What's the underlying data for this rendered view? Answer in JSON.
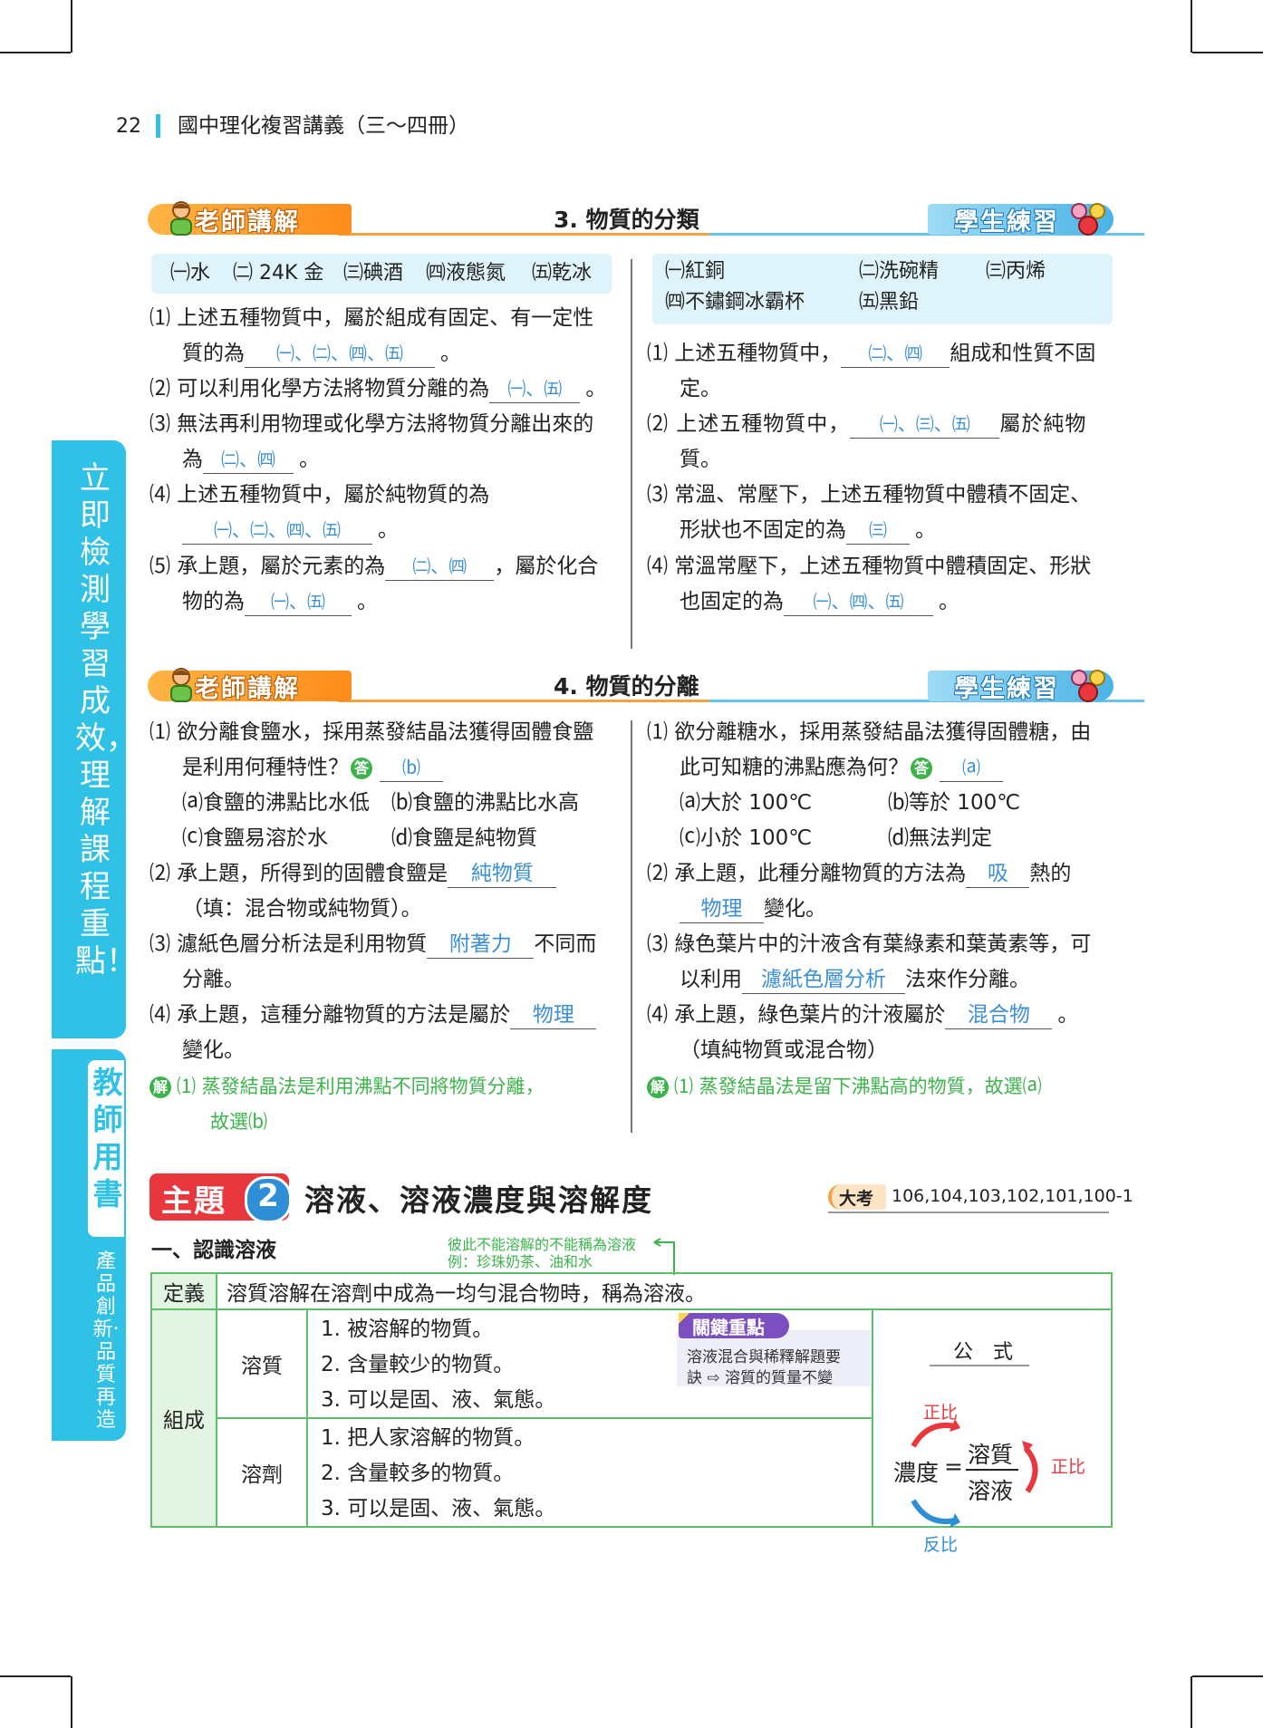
{
  "header": {
    "page_number": "22",
    "book_title": "國中理化複習講義（三～四冊）"
  },
  "sidebar": {
    "main_text": "立即檢測學習成效，理解課程重點！",
    "teacher_book": "教師用書",
    "slogan": "產品創新‧品質再造"
  },
  "banners": {
    "teacher_label": "老師講解",
    "student_label": "學生練習"
  },
  "section3": {
    "title": "3. 物質的分類",
    "left_box": [
      "㈠水",
      "㈡ 24K 金",
      "㈢碘酒",
      "㈣液態氮",
      "㈤乾冰"
    ],
    "right_box": [
      "㈠紅銅",
      "㈡洗碗精",
      "㈢丙烯",
      "㈣不鏽鋼冰霸杯",
      "㈤黑鉛"
    ],
    "left_q1_a": "⑴ 上述五種物質中，屬於組成有固定、有一定性",
    "left_q1_b": "質的為",
    "left_q1_ans": "㈠、㈡、㈣、㈤",
    "left_q2": "⑵ 可以利用化學方法將物質分離的為",
    "left_q2_ans": "㈠、㈤",
    "left_q3_a": "⑶ 無法再利用物理或化學方法將物質分離出來的",
    "left_q3_b": "為",
    "left_q3_ans": "㈡、㈣",
    "left_q4_a": "⑷ 上述五種物質中，屬於純物質的為",
    "left_q4_ans": "㈠、㈡、㈣、㈤",
    "left_q5_a": "⑸ 承上題，屬於元素的為",
    "left_q5_ans1": "㈡、㈣",
    "left_q5_mid": "，屬於化合",
    "left_q5_b": "物的為",
    "left_q5_ans2": "㈠、㈤",
    "right_q1_a": "⑴ 上述五種物質中，",
    "right_q1_ans": "㈡、㈣",
    "right_q1_b": "組成和性質不固",
    "right_q1_c": "定。",
    "right_q2_a": "⑵ 上述五種物質中，",
    "right_q2_ans": "㈠、㈢、㈤",
    "right_q2_b": "屬於純物",
    "right_q2_c": "質。",
    "right_q3_a": "⑶ 常溫、常壓下，上述五種物質中體積不固定、",
    "right_q3_b": "形狀也不固定的為",
    "right_q3_ans": "㈢",
    "right_q4_a": "⑷ 常溫常壓下，上述五種物質中體積固定、形狀",
    "right_q4_b": "也固定的為",
    "right_q4_ans": "㈠、㈣、㈤",
    "period": "。"
  },
  "section4": {
    "title": "4. 物質的分離",
    "left_q1_a": "⑴ 欲分離食鹽水，採用蒸發結晶法獲得固體食鹽",
    "left_q1_b": "是利用何種特性？",
    "answer_mark": "答",
    "left_q1_ans": "⒝",
    "left_q1_opt_a": "⒜食鹽的沸點比水低",
    "left_q1_opt_b": "⒝食鹽的沸點比水高",
    "left_q1_opt_c": "⒞食鹽易溶於水",
    "left_q1_opt_d": "⒟食鹽是純物質",
    "left_q2_a": "⑵ 承上題，所得到的固體食鹽是",
    "left_q2_ans": "純物質",
    "left_q2_b": "（填：混合物或純物質）。",
    "left_q3_a": "⑶ 濾紙色層分析法是利用物質",
    "left_q3_ans": "附著力",
    "left_q3_b": "不同而",
    "left_q3_c": "分離。",
    "left_q4_a": "⑷ 承上題，這種分離物質的方法是屬於",
    "left_q4_ans": "物理",
    "left_q4_b": "變化。",
    "explain_mark": "解",
    "left_explain_a": "⑴ 蒸發結晶法是利用沸點不同將物質分離，",
    "left_explain_b": "故選⒝",
    "right_q1_a": "⑴ 欲分離糖水，採用蒸發結晶法獲得固體糖，由",
    "right_q1_b": "此可知糖的沸點應為何？",
    "right_q1_ans": "⒜",
    "right_q1_opt_a": "⒜大於 100℃",
    "right_q1_opt_b": "⒝等於 100℃",
    "right_q1_opt_c": "⒞小於 100℃",
    "right_q1_opt_d": "⒟無法判定",
    "right_q2_a": "⑵ 承上題，此種分離物質的方法為",
    "right_q2_ans1": "吸",
    "right_q2_b": "熱的",
    "right_q2_ans2": "物理",
    "right_q2_c": "變化。",
    "right_q3_a": "⑶ 綠色葉片中的汁液含有葉綠素和葉黃素等，可",
    "right_q3_b": "以利用",
    "right_q3_ans": "濾紙色層分析",
    "right_q3_c": "法來作分離。",
    "right_q4_a": "⑷ 承上題，綠色葉片的汁液屬於",
    "right_q4_ans": "混合物",
    "right_q4_b": "（填純物質或混合物）",
    "right_explain": "⑴ 蒸發結晶法是留下沸點高的物質，故選⒜",
    "period": "。"
  },
  "topic2": {
    "label": "主題",
    "number": "2",
    "title": "溶液、溶液濃度與溶解度",
    "exam_label": "大考",
    "exam_years": "106,104,103,102,101,100-1",
    "subheading": "一、認識溶液",
    "note_line1": "彼此不能溶解的不能稱為溶液",
    "note_line2": "例：珍珠奶茶、油和水",
    "table": {
      "def_label": "定義",
      "def_text": "溶質溶解在溶劑中成為一均勻混合物時，稱為溶液。",
      "comp_label": "組成",
      "solute_label": "溶質",
      "solute_items": [
        "1. 被溶解的物質。",
        "2. 含量較少的物質。",
        "3. 可以是固、液、氣態。"
      ],
      "solvent_label": "溶劑",
      "solvent_items": [
        "1. 把人家溶解的物質。",
        "2. 含量較多的物質。",
        "3. 可以是固、液、氣態。"
      ],
      "key_label": "關鍵重點",
      "key_text_1": "溶液混合與稀釋解題要",
      "key_text_2": "訣 ⇨ 溶質的質量不變",
      "formula_label": "公　式",
      "formula_lhs": "濃度",
      "formula_eq": "=",
      "formula_num": "溶質",
      "formula_den": "溶液",
      "prop_top": "正比",
      "prop_right": "正比",
      "prop_bottom": "反比"
    }
  },
  "colors": {
    "accent_orange": "#ff8c1a",
    "accent_blue": "#49b3e6",
    "sidebar": "#2fc1e6",
    "answer": "#3a8fd6",
    "table_border": "#5dbf6a",
    "topic_red": "#e8383d"
  }
}
